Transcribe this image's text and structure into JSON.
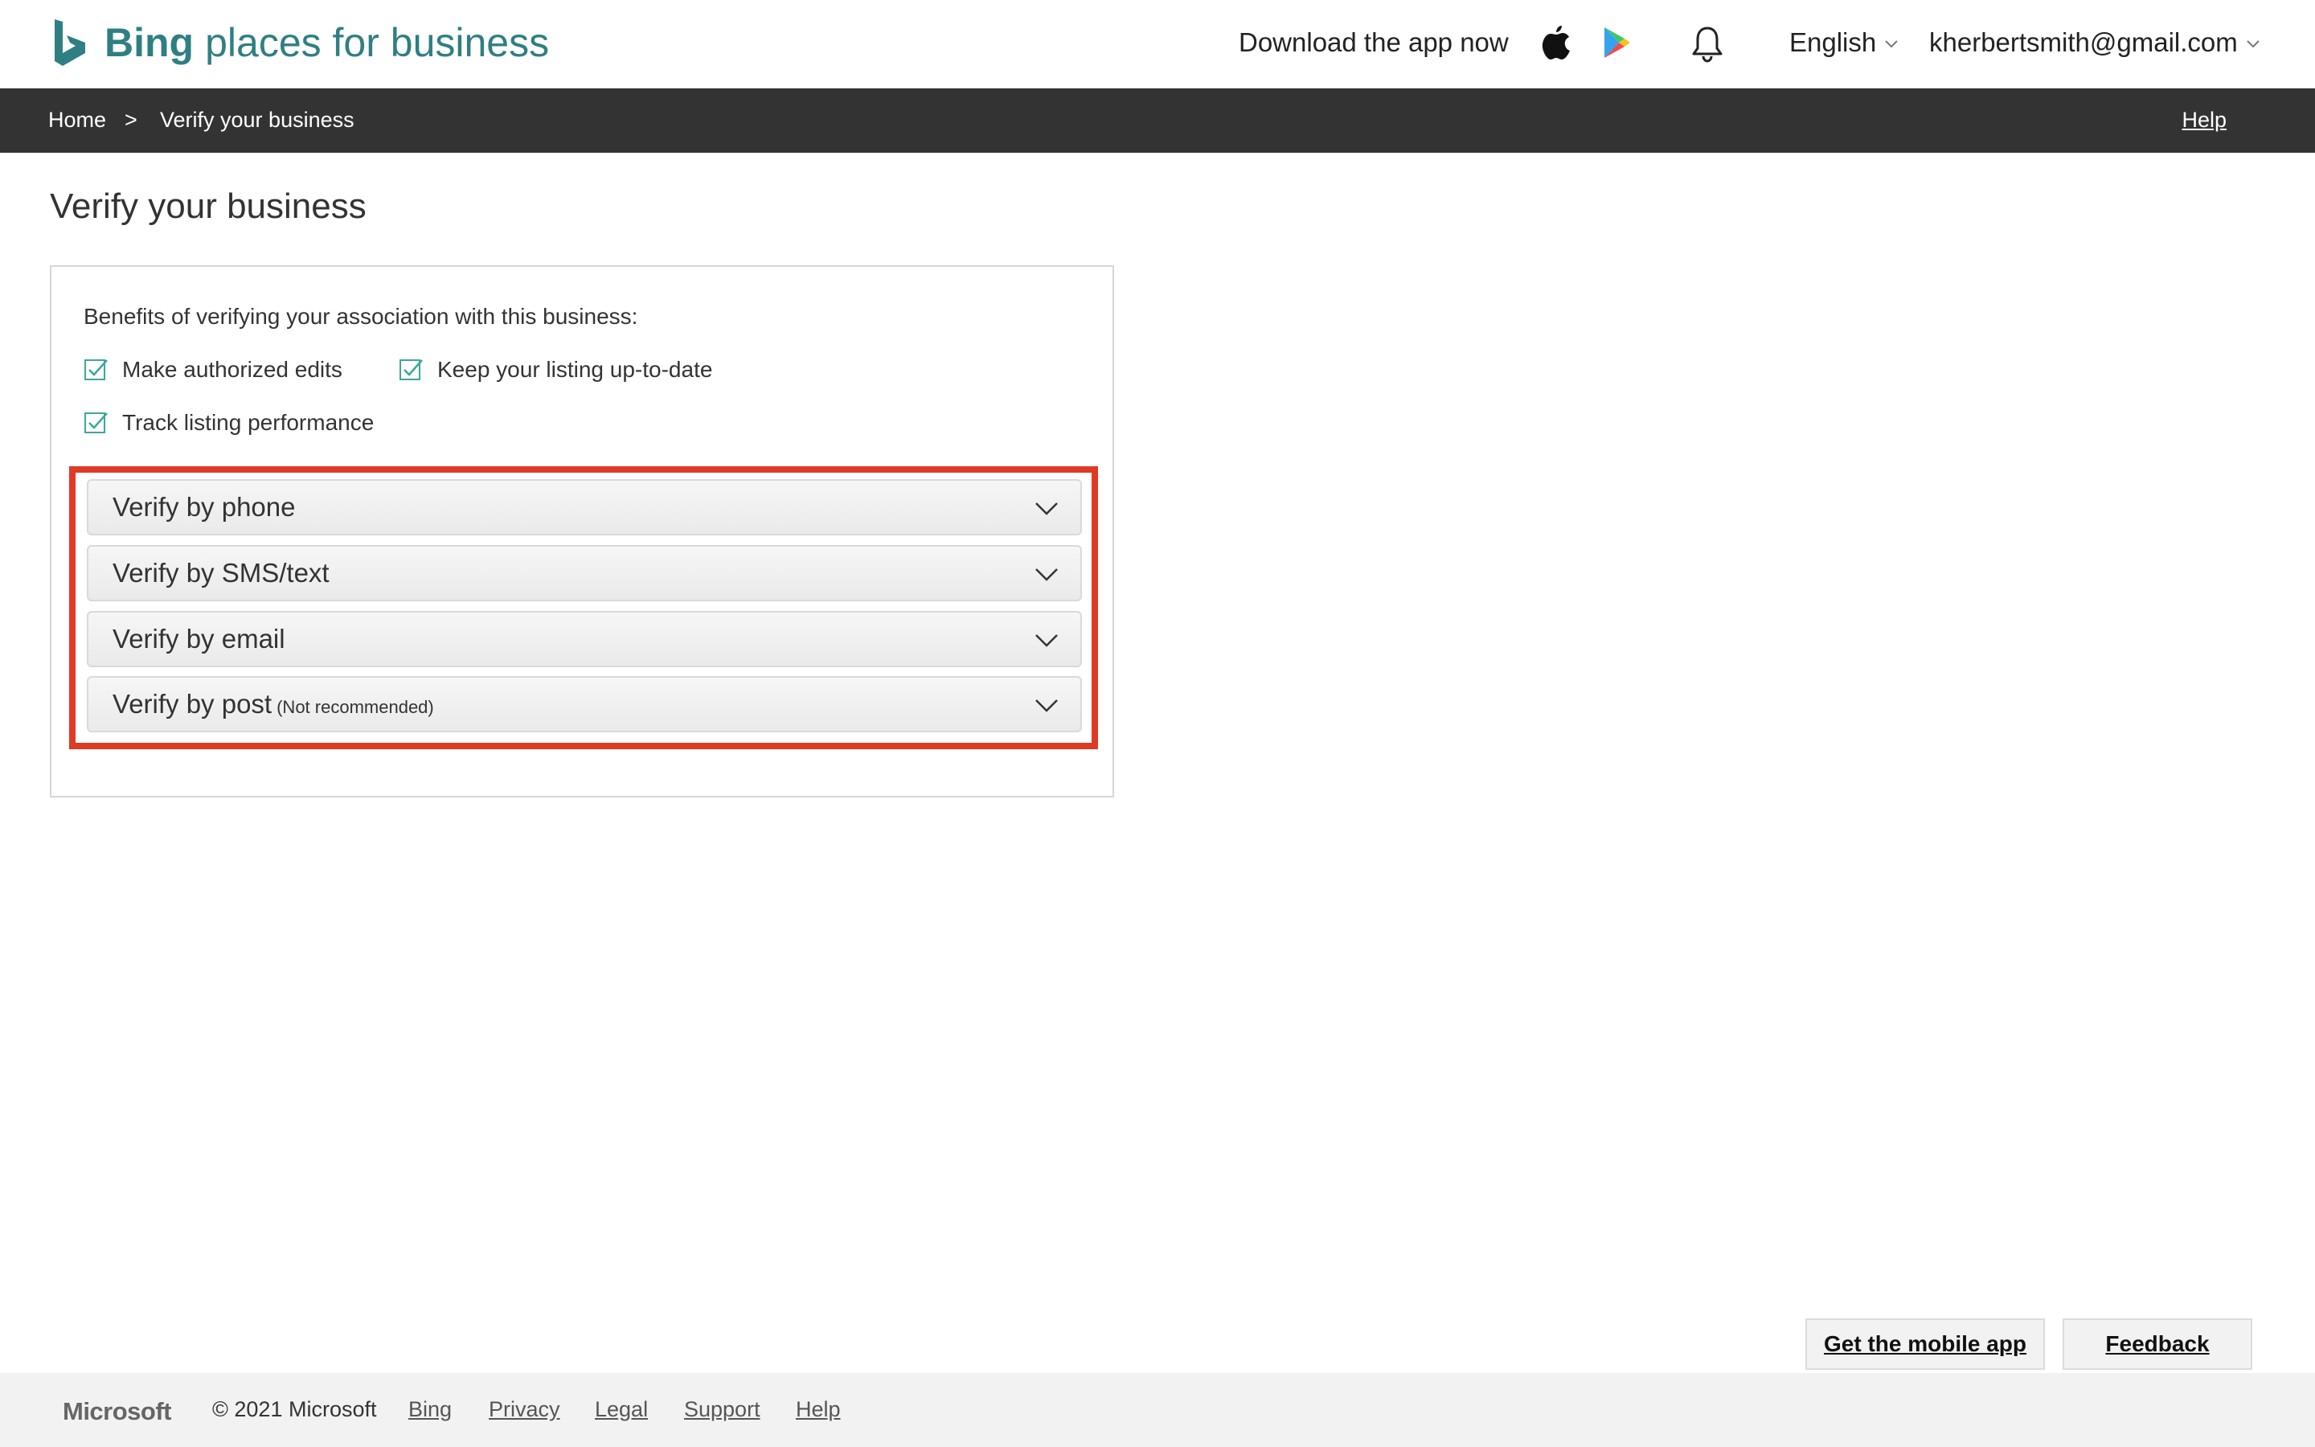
{
  "header": {
    "brand_bing": "Bing",
    "brand_rest": "places for business",
    "download_text": "Download the app now",
    "language": "English",
    "user_email": "kherbertsmith@gmail.com",
    "brand_color": "#2f7f82"
  },
  "breadcrumb": {
    "home": "Home",
    "separator": ">",
    "current": "Verify your business",
    "help": "Help"
  },
  "main": {
    "title": "Verify your business",
    "benefits_title": "Benefits of verifying your association with this business:",
    "benefits": [
      "Make authorized edits",
      "Keep your listing up-to-date",
      "Track listing performance"
    ],
    "options": [
      {
        "label": "Verify by phone",
        "note": ""
      },
      {
        "label": "Verify by SMS/text",
        "note": ""
      },
      {
        "label": "Verify by email",
        "note": ""
      },
      {
        "label": "Verify by post",
        "note": "(Not recommended)"
      }
    ],
    "highlight_color": "#e03a25"
  },
  "footer_buttons": {
    "mobile_app": "Get the mobile app",
    "feedback": "Feedback"
  },
  "footer": {
    "microsoft": "Microsoft",
    "copyright": "© 2021 Microsoft",
    "links": [
      "Bing",
      "Privacy",
      "Legal",
      "Support",
      "Help"
    ]
  }
}
